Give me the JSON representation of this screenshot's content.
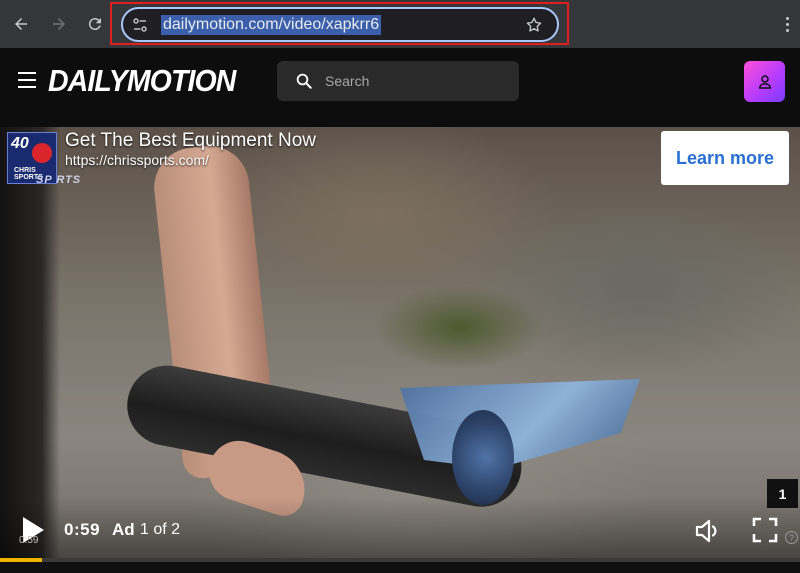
{
  "browser": {
    "url": "dailymotion.com/video/xapkrr6",
    "icons": {
      "back": "arrow-left-icon",
      "forward": "arrow-right-icon",
      "reload": "reload-icon",
      "site_info": "tune-icon",
      "bookmark": "star-icon",
      "menu": "kebab-menu-icon"
    },
    "highlight_color": "#e01e1e"
  },
  "site": {
    "logo": "DAILYMOTION",
    "search": {
      "placeholder": "Search"
    },
    "brand_gradient": [
      "#ff4fd8",
      "#7a3cff"
    ]
  },
  "ad": {
    "logo_number": "40",
    "logo_text": "CHRIS SPORTS",
    "logo_sub": "SP RTS",
    "title": "Get The Best Equipment Now",
    "url": "https://chrissports.com/",
    "cta": "Learn more",
    "cta_color": "#2a6fd4",
    "count": "1",
    "time_remaining": "0:59",
    "label": "Ad",
    "position": "1 of 2"
  },
  "player": {
    "tiny_time": "0:59",
    "progress_fraction": 0.053,
    "progress_color": "#f0b400",
    "help": "?"
  }
}
